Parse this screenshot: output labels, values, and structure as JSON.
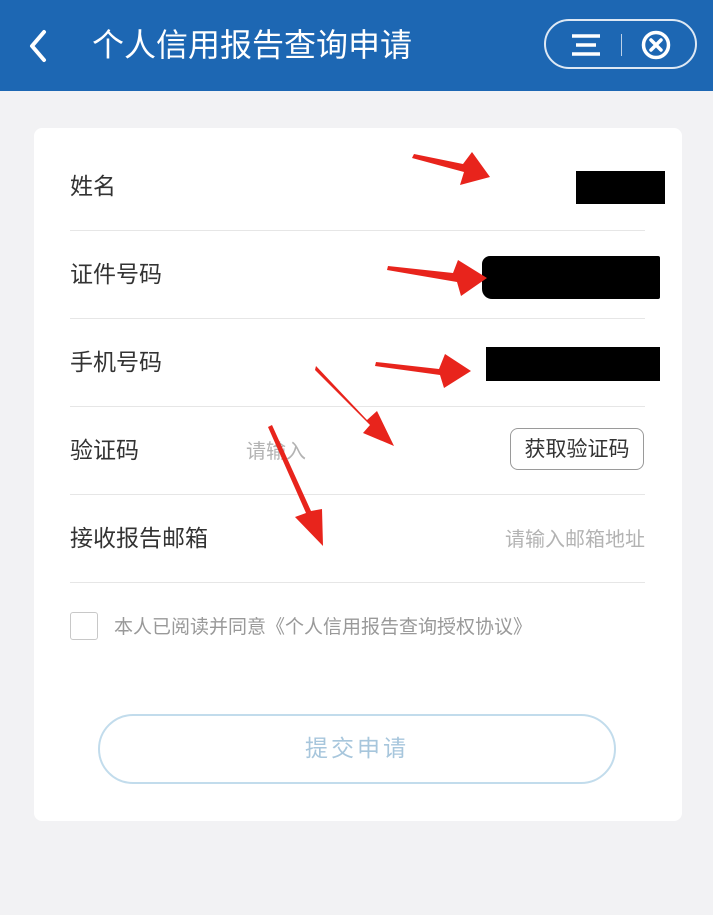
{
  "header": {
    "title": "个人信用报告查询申请",
    "back_icon": "chevron-left-icon",
    "menu_icon": "menu-icon",
    "close_icon": "circle-close-icon",
    "background": "#1d67b3"
  },
  "form": {
    "name": {
      "label": "姓名"
    },
    "id_number": {
      "label": "证件号码"
    },
    "phone": {
      "label": "手机号码"
    },
    "verification": {
      "label": "验证码",
      "placeholder": "请输入",
      "button_label": "获取验证码"
    },
    "email": {
      "label": "接收报告邮箱",
      "placeholder": "请输入邮箱地址"
    }
  },
  "agreement": {
    "text": "本人已阅读并同意《个人信用报告查询授权协议》",
    "checked": false
  },
  "submit": {
    "label": "提交申请",
    "enabled": false
  },
  "annotations": {
    "arrow_color": "#e8241c"
  }
}
